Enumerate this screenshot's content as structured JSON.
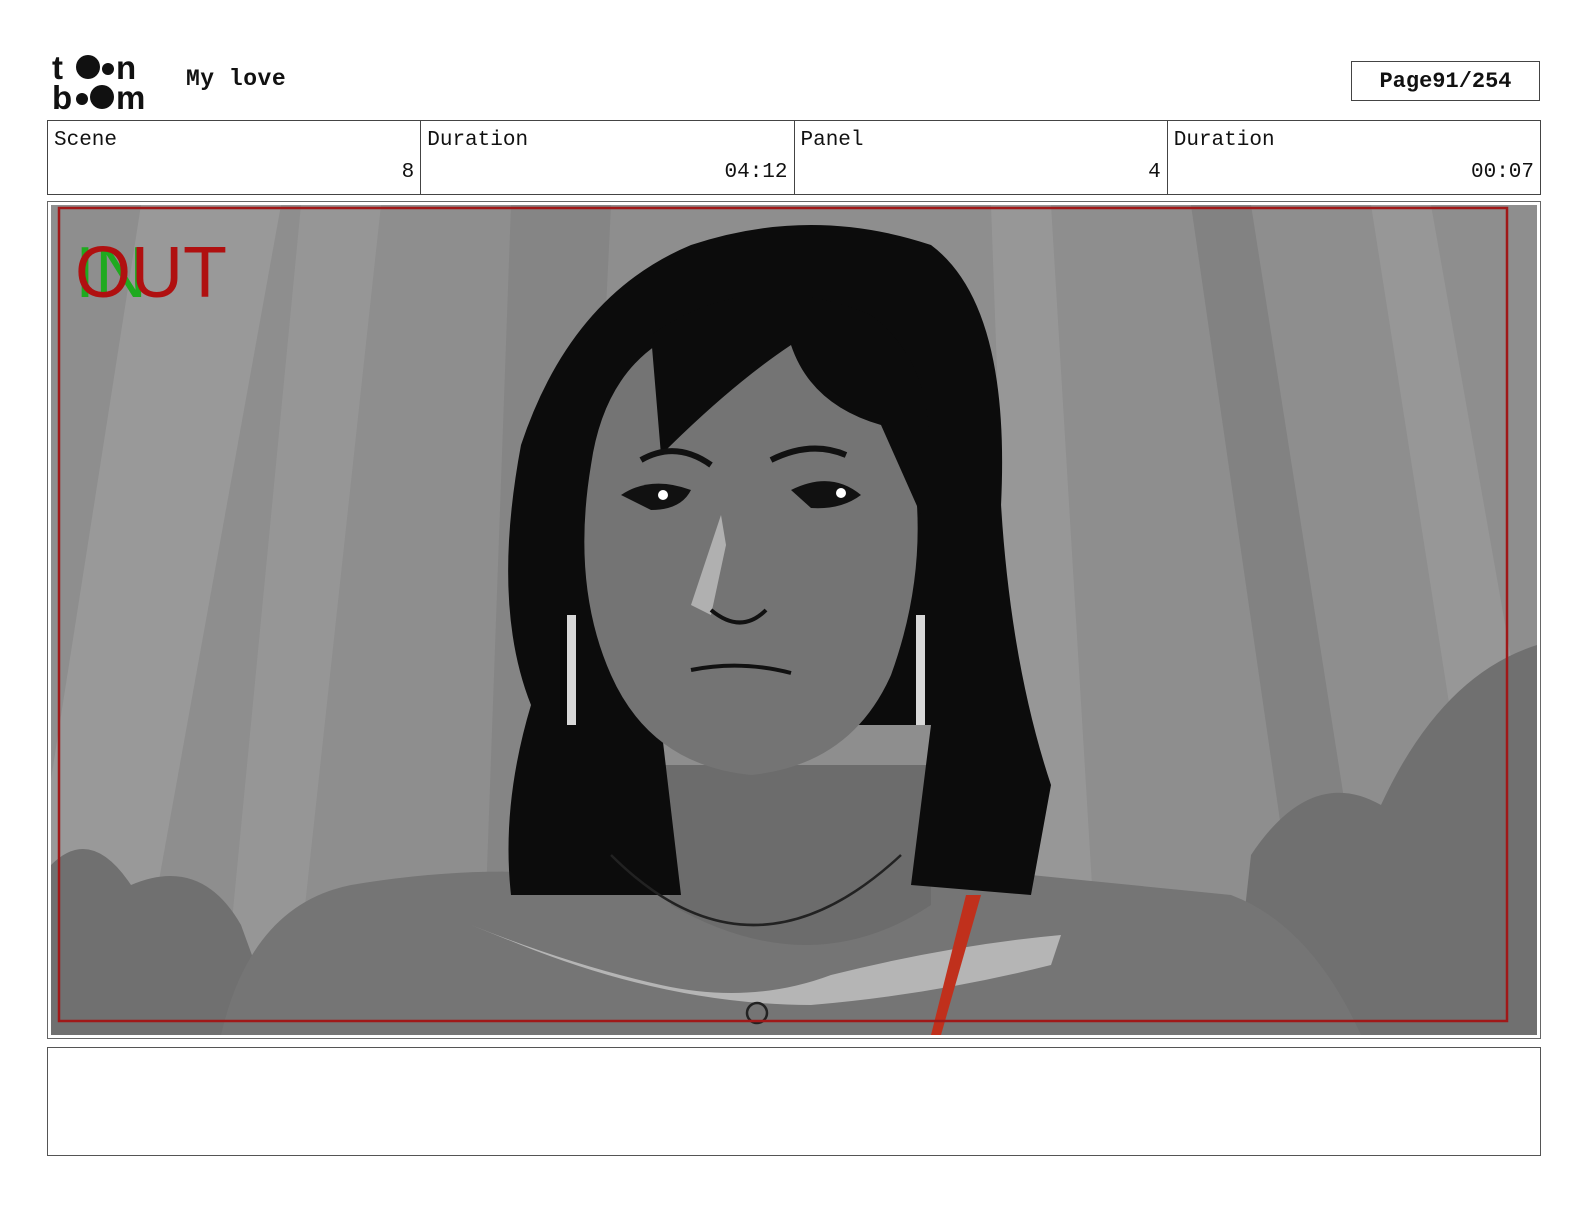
{
  "header": {
    "project_title": "My love",
    "page_label": "Page",
    "page_value": "91/254"
  },
  "info": {
    "scene_label": "Scene",
    "scene_value": "8",
    "scene_duration_label": "Duration",
    "scene_duration_value": "04:12",
    "panel_label": "Panel",
    "panel_value": "4",
    "panel_duration_label": "Duration",
    "panel_duration_value": "00:07"
  },
  "panel": {
    "transition_in": "IN",
    "transition_out": "OUT"
  },
  "colors": {
    "safe_frame": "#a01818",
    "in_text": "#1faa1f",
    "out_text": "#b01010",
    "background": "#8e8e8e"
  }
}
